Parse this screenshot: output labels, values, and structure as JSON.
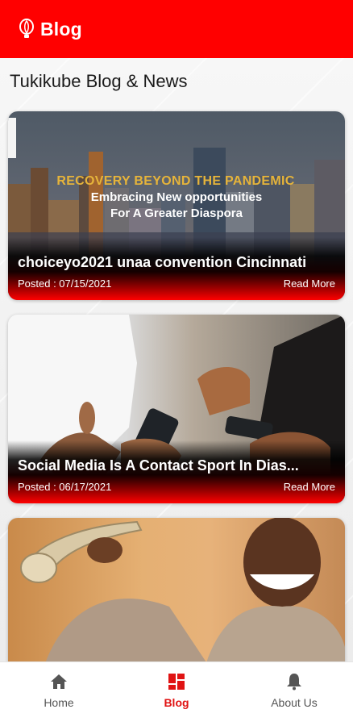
{
  "app_bar": {
    "title": "Blog",
    "logo_icon": "balloon-logo-icon",
    "background": "#ff0000"
  },
  "page": {
    "heading": "Tukikube Blog & News"
  },
  "posts": [
    {
      "banner": {
        "line1": "RECOVERY BEYOND THE PANDEMIC",
        "line2": "Embracing New opportunities",
        "line3": "For A Greater Diaspora"
      },
      "title": "choiceyo2021 unaa convention Cincinnati",
      "posted": "Posted : 07/15/2021",
      "read_more": "Read More"
    },
    {
      "title": "Social Media Is A Contact Sport In Dias...",
      "posted": "Posted : 06/17/2021",
      "read_more": "Read More"
    },
    {
      "title": "",
      "posted": "",
      "read_more": ""
    }
  ],
  "bottom_nav": {
    "items": [
      {
        "label": "Home",
        "icon": "home-icon",
        "active": false
      },
      {
        "label": "Blog",
        "icon": "grid-icon",
        "active": true
      },
      {
        "label": "About Us",
        "icon": "bell-icon",
        "active": false
      }
    ],
    "active_color": "#e01313"
  }
}
